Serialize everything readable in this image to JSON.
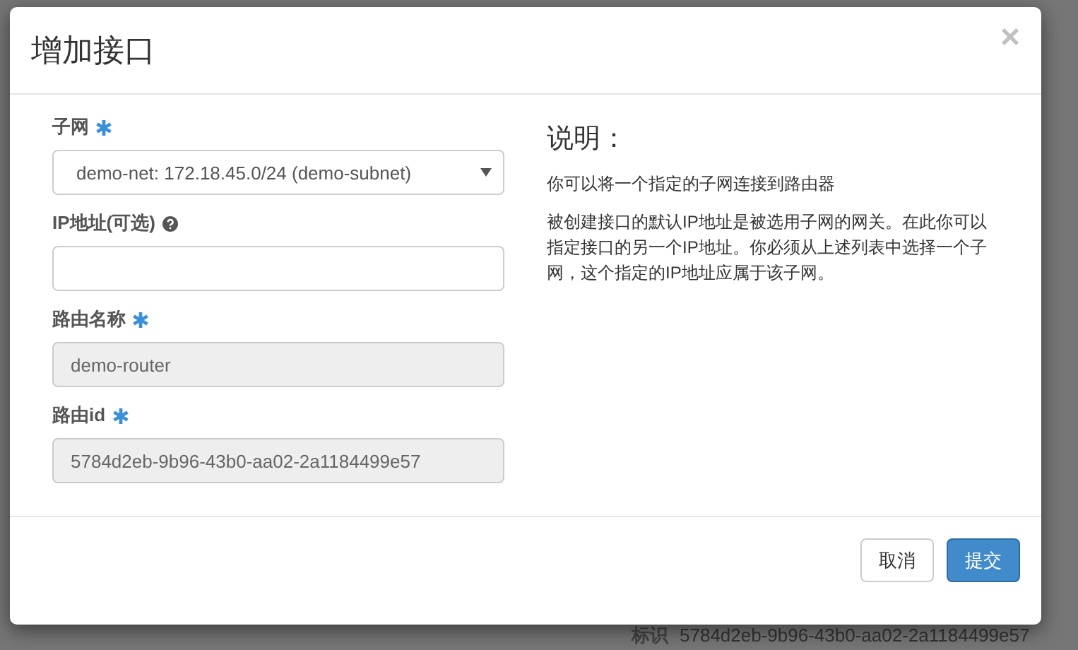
{
  "background": {
    "detail_label": "标识",
    "detail_value": "5784d2eb-9b96-43b0-aa02-2a1184499e57"
  },
  "dialog": {
    "title": "增加接口",
    "close": "×",
    "fields": [
      {
        "kind": "select",
        "label": "子网",
        "required": true,
        "help": false,
        "value": "demo-net: 172.18.45.0/24 (demo-subnet)",
        "disabled": false
      },
      {
        "kind": "text",
        "label": "IP地址(可选)",
        "required": false,
        "help": true,
        "disabled": false
      },
      {
        "kind": "text",
        "label": "路由名称",
        "required": true,
        "help": false,
        "value": "demo-router",
        "disabled": true
      },
      {
        "kind": "text",
        "label": "路由id",
        "required": true,
        "help": false,
        "value": "5784d2eb-9b96-43b0-aa02-2a1184499e57",
        "disabled": true
      }
    ],
    "description": {
      "heading": "说明：",
      "paragraphs": [
        "你可以将一个指定的子网连接到路由器",
        "被创建接口的默认IP地址是被选用子网的网关。在此你可以指定接口的另一个IP地址。你必须从上述列表中选择一个子网，这个指定的IP地址应属于该子网。"
      ]
    },
    "buttons": [
      {
        "label": "取消",
        "primary": false
      },
      {
        "label": "提交",
        "primary": true
      }
    ]
  }
}
